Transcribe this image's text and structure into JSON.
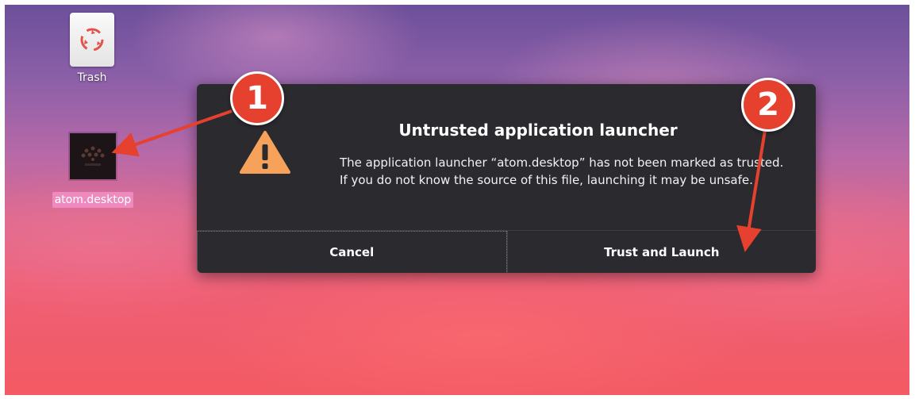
{
  "desktop": {
    "trash_label": "Trash",
    "launcher_label": "atom.desktop"
  },
  "dialog": {
    "title": "Untrusted application launcher",
    "body": "The application launcher “atom.desktop” has not been marked as trusted. If you do not know the source of this file, launching it may be unsafe.",
    "icon": "warning-icon",
    "cancel_label": "Cancel",
    "trust_label": "Trust and Launch"
  },
  "annotations": {
    "step1": "1",
    "step2": "2",
    "color": "#e6402e"
  }
}
